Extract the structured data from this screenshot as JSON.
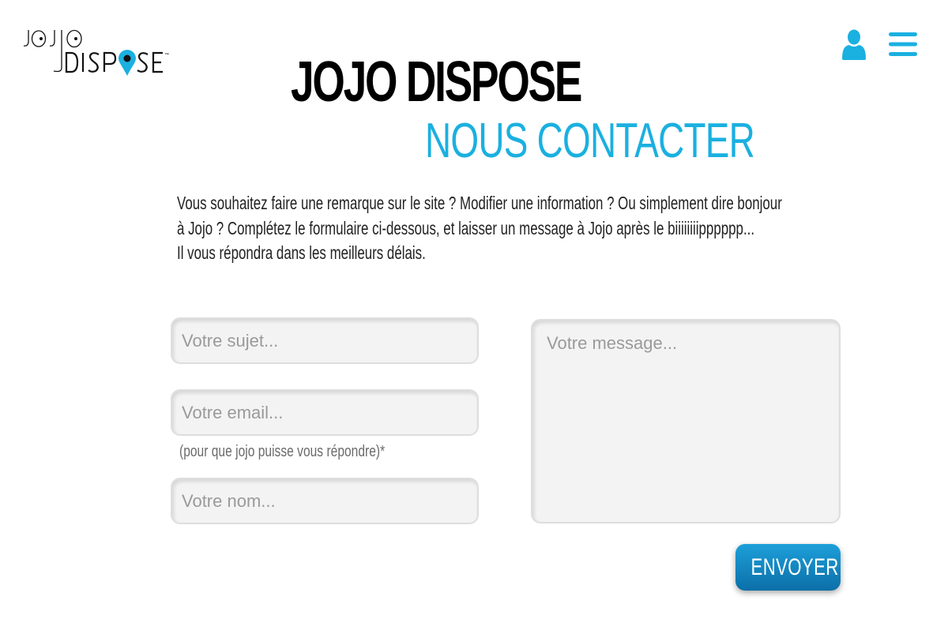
{
  "brand": {
    "logo_top": "JOJO",
    "logo_bottom": "DISPOSE",
    "trademark": "™",
    "accent_color": "#1ab0e0",
    "button_color": "#0c6fa8"
  },
  "header": {
    "title": "JOJO DISPOSE",
    "subtitle": "NOUS CONTACTER",
    "icons": [
      "user-icon",
      "hamburger-menu-icon"
    ]
  },
  "intro": {
    "line1": "Vous souhaitez faire une remarque sur le site ? Modifier une information ? Ou simplement dire bonjour",
    "line2": "à Jojo ? Complétez le formulaire ci-dessous, et laisser un message à Jojo après le biiiiiiiipppppp...",
    "line3": "Il vous répondra dans les meilleurs délais."
  },
  "form": {
    "subject_placeholder": "Votre sujet...",
    "subject_value": "",
    "email_placeholder": "Votre email...",
    "email_value": "",
    "email_hint": "(pour que jojo puisse vous répondre)*",
    "name_placeholder": "Votre nom...",
    "name_value": "",
    "message_placeholder": "Votre message...",
    "message_value": "",
    "submit_label": "ENVOYER"
  }
}
